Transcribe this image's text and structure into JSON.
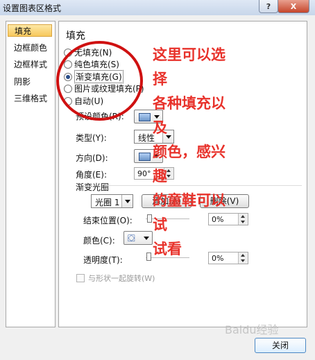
{
  "window": {
    "title": "设置图表区格式",
    "help_label": "?",
    "close_label": "X"
  },
  "sidebar": {
    "items": [
      {
        "label": "填充"
      },
      {
        "label": "边框颜色"
      },
      {
        "label": "边框样式"
      },
      {
        "label": "阴影"
      },
      {
        "label": "三维格式"
      }
    ]
  },
  "fill": {
    "section_title": "填充",
    "options": [
      {
        "label": "无填充(N)"
      },
      {
        "label": "纯色填充(S)"
      },
      {
        "label": "渐变填充(G)",
        "selected": true
      },
      {
        "label": "图片或纹理填充(P)"
      },
      {
        "label": "自动(U)"
      }
    ],
    "preset_label": "预设颜色(R):",
    "type_label": "类型(Y):",
    "type_value": "线性",
    "direction_label": "方向(D):",
    "angle_label": "角度(E):",
    "angle_value": "90°",
    "gradient_stops_label": "渐变光圈",
    "stop_value": "光圈 1",
    "add_button": "添加(A)",
    "delete_button": "删除(V)",
    "end_position_label": "结束位置(O):",
    "end_position_value": "0%",
    "color_label": "颜色(C):",
    "transparency_label": "透明度(T):",
    "transparency_value": "0%",
    "rotate_with_shape_label": "与形状一起旋转(W)"
  },
  "annotation": {
    "text": "这里可以选择\n各种填充以及\n颜色，感兴趣\n的童鞋可以试\n试看"
  },
  "footer": {
    "close_button": "关闭",
    "watermark": "Baidu经验"
  },
  "colors": {
    "accent": "#e8322b",
    "selected_nav": "#f7c85c"
  }
}
